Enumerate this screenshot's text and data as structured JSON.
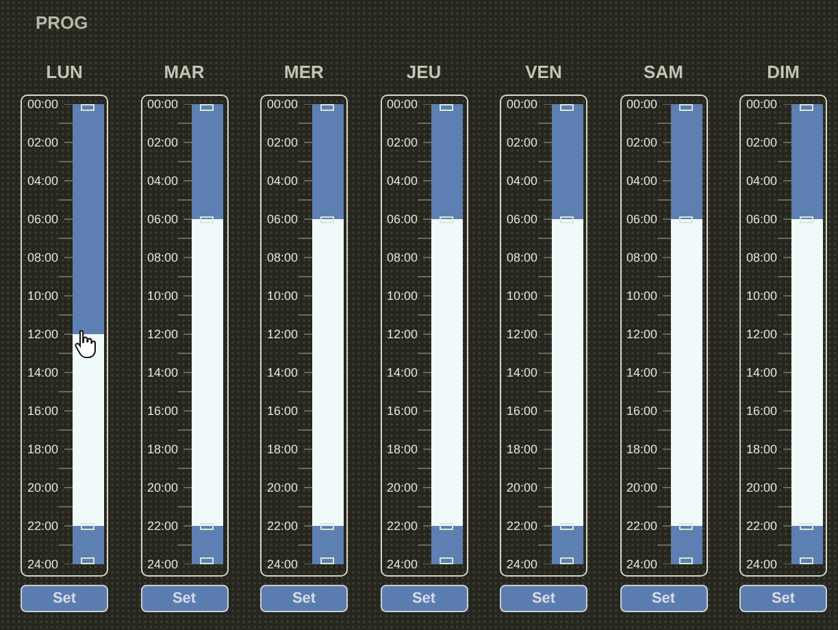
{
  "title": "PROG",
  "days": [
    {
      "label": "LUN",
      "hours": [
        "00:00",
        "02:00",
        "04:00",
        "06:00",
        "08:00",
        "10:00",
        "12:00",
        "14:00",
        "16:00",
        "18:00",
        "20:00",
        "22:00",
        "24:00"
      ],
      "off_top": {
        "level": 0.5
      },
      "off_bottom": {
        "level": 0.0833
      },
      "button": "Set"
    },
    {
      "label": "MAR",
      "hours": [
        "00:00",
        "02:00",
        "04:00",
        "06:00",
        "08:00",
        "10:00",
        "12:00",
        "14:00",
        "16:00",
        "18:00",
        "20:00",
        "22:00",
        "24:00"
      ],
      "off_top": {
        "level": 0.25
      },
      "off_bottom": {
        "level": 0.0833
      },
      "button": "Set"
    },
    {
      "label": "MER",
      "hours": [
        "00:00",
        "02:00",
        "04:00",
        "06:00",
        "08:00",
        "10:00",
        "12:00",
        "14:00",
        "16:00",
        "18:00",
        "20:00",
        "22:00",
        "24:00"
      ],
      "off_top": {
        "level": 0.25
      },
      "off_bottom": {
        "level": 0.0833
      },
      "button": "Set"
    },
    {
      "label": "JEU",
      "hours": [
        "00:00",
        "02:00",
        "04:00",
        "06:00",
        "08:00",
        "10:00",
        "12:00",
        "14:00",
        "16:00",
        "18:00",
        "20:00",
        "22:00",
        "24:00"
      ],
      "off_top": {
        "level": 0.25
      },
      "off_bottom": {
        "level": 0.0833
      },
      "button": "Set"
    },
    {
      "label": "VEN",
      "hours": [
        "00:00",
        "02:00",
        "04:00",
        "06:00",
        "08:00",
        "10:00",
        "12:00",
        "14:00",
        "16:00",
        "18:00",
        "20:00",
        "22:00",
        "24:00"
      ],
      "off_top": {
        "level": 0.25
      },
      "off_bottom": {
        "level": 0.0833
      },
      "button": "Set"
    },
    {
      "label": "SAM",
      "hours": [
        "00:00",
        "02:00",
        "04:00",
        "06:00",
        "08:00",
        "10:00",
        "12:00",
        "14:00",
        "16:00",
        "18:00",
        "20:00",
        "22:00",
        "24:00"
      ],
      "off_top": {
        "level": 0.25
      },
      "off_bottom": {
        "level": 0.0833
      },
      "button": "Set"
    },
    {
      "label": "DIM",
      "hours": [
        "00:00",
        "02:00",
        "04:00",
        "06:00",
        "08:00",
        "10:00",
        "12:00",
        "14:00",
        "16:00",
        "18:00",
        "20:00",
        "22:00",
        "24:00"
      ],
      "off_top": {
        "level": 0.25
      },
      "off_bottom": {
        "level": 0.0833
      },
      "button": "Set"
    }
  ]
}
